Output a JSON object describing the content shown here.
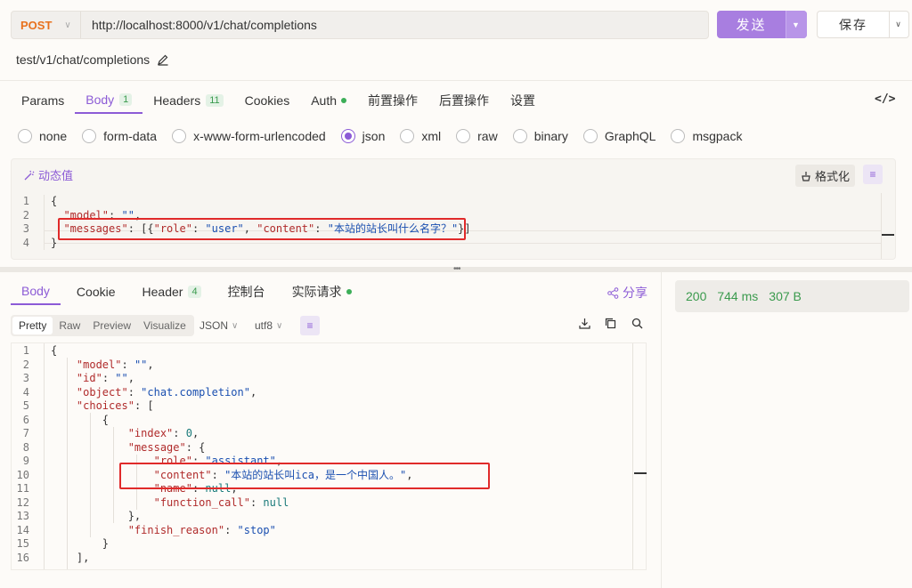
{
  "request": {
    "method": "POST",
    "url": "http://localhost:8000/v1/chat/completions",
    "send_label": "发送",
    "save_label": "保存",
    "path": "test/v1/chat/completions"
  },
  "req_tabs": [
    {
      "label": "Params"
    },
    {
      "label": "Body",
      "badge": "1",
      "active": true
    },
    {
      "label": "Headers",
      "badge": "11"
    },
    {
      "label": "Cookies"
    },
    {
      "label": "Auth",
      "dot": true
    },
    {
      "label": "前置操作"
    },
    {
      "label": "后置操作"
    },
    {
      "label": "设置"
    }
  ],
  "body_types": [
    {
      "label": "none"
    },
    {
      "label": "form-data"
    },
    {
      "label": "x-www-form-urlencoded"
    },
    {
      "label": "json",
      "checked": true
    },
    {
      "label": "xml"
    },
    {
      "label": "raw"
    },
    {
      "label": "binary"
    },
    {
      "label": "GraphQL"
    },
    {
      "label": "msgpack"
    }
  ],
  "editor": {
    "dynamic_label": "动态值",
    "format_label": "格式化"
  },
  "request_body_lines": [
    {
      "n": "1",
      "parts": [
        [
          "p",
          "{"
        ]
      ]
    },
    {
      "n": "2",
      "parts": [
        [
          "p",
          "  "
        ],
        [
          "k",
          "\"model\""
        ],
        [
          "p",
          ": "
        ],
        [
          "s",
          "\"\""
        ],
        [
          "p",
          ","
        ]
      ]
    },
    {
      "n": "3",
      "parts": [
        [
          "p",
          "  "
        ],
        [
          "k",
          "\"messages\""
        ],
        [
          "p",
          ": [{"
        ],
        [
          "k",
          "\"role\""
        ],
        [
          "p",
          ": "
        ],
        [
          "s",
          "\"user\""
        ],
        [
          "p",
          ", "
        ],
        [
          "k",
          "\"content\""
        ],
        [
          "p",
          ": "
        ],
        [
          "s",
          "\"本站的站长叫什么名字？\""
        ],
        [
          "p",
          "}]"
        ]
      ]
    },
    {
      "n": "4",
      "parts": [
        [
          "p",
          "}"
        ]
      ]
    }
  ],
  "resp_tabs": [
    {
      "label": "Body",
      "active": true
    },
    {
      "label": "Cookie"
    },
    {
      "label": "Header",
      "badge": "4"
    },
    {
      "label": "控制台"
    },
    {
      "label": "实际请求",
      "dot": true
    }
  ],
  "share_label": "分享",
  "view_modes": [
    {
      "label": "Pretty",
      "active": true
    },
    {
      "label": "Raw"
    },
    {
      "label": "Preview"
    },
    {
      "label": "Visualize"
    }
  ],
  "format_select": "JSON",
  "encoding_select": "utf8",
  "response_lines": [
    {
      "n": "1",
      "parts": [
        [
          "p",
          "{"
        ]
      ]
    },
    {
      "n": "2",
      "parts": [
        [
          "p",
          "    "
        ],
        [
          "k",
          "\"model\""
        ],
        [
          "p",
          ": "
        ],
        [
          "s",
          "\"\""
        ],
        [
          "p",
          ","
        ]
      ]
    },
    {
      "n": "3",
      "parts": [
        [
          "p",
          "    "
        ],
        [
          "k",
          "\"id\""
        ],
        [
          "p",
          ": "
        ],
        [
          "s",
          "\"\""
        ],
        [
          "p",
          ","
        ]
      ]
    },
    {
      "n": "4",
      "parts": [
        [
          "p",
          "    "
        ],
        [
          "k",
          "\"object\""
        ],
        [
          "p",
          ": "
        ],
        [
          "s",
          "\"chat.completion\""
        ],
        [
          "p",
          ","
        ]
      ]
    },
    {
      "n": "5",
      "parts": [
        [
          "p",
          "    "
        ],
        [
          "k",
          "\"choices\""
        ],
        [
          "p",
          ": ["
        ]
      ]
    },
    {
      "n": "6",
      "parts": [
        [
          "p",
          "        {"
        ]
      ]
    },
    {
      "n": "7",
      "parts": [
        [
          "p",
          "            "
        ],
        [
          "k",
          "\"index\""
        ],
        [
          "p",
          ": "
        ],
        [
          "n",
          "0"
        ],
        [
          "p",
          ","
        ]
      ]
    },
    {
      "n": "8",
      "parts": [
        [
          "p",
          "            "
        ],
        [
          "k",
          "\"message\""
        ],
        [
          "p",
          ": {"
        ]
      ]
    },
    {
      "n": "9",
      "parts": [
        [
          "p",
          "                "
        ],
        [
          "k",
          "\"role\""
        ],
        [
          "p",
          ": "
        ],
        [
          "s",
          "\"assistant\""
        ],
        [
          "p",
          ","
        ]
      ]
    },
    {
      "n": "10",
      "parts": [
        [
          "p",
          "                "
        ],
        [
          "k",
          "\"content\""
        ],
        [
          "p",
          ": "
        ],
        [
          "s",
          "\"本站的站长叫ica，是一个中国人。\""
        ],
        [
          "p",
          ","
        ]
      ]
    },
    {
      "n": "11",
      "parts": [
        [
          "p",
          "                "
        ],
        [
          "k",
          "\"name\""
        ],
        [
          "p",
          ": "
        ],
        [
          "n",
          "null"
        ],
        [
          "p",
          ","
        ]
      ]
    },
    {
      "n": "12",
      "parts": [
        [
          "p",
          "                "
        ],
        [
          "k",
          "\"function_call\""
        ],
        [
          "p",
          ": "
        ],
        [
          "n",
          "null"
        ]
      ]
    },
    {
      "n": "13",
      "parts": [
        [
          "p",
          "            },"
        ]
      ]
    },
    {
      "n": "14",
      "parts": [
        [
          "p",
          "            "
        ],
        [
          "k",
          "\"finish_reason\""
        ],
        [
          "p",
          ": "
        ],
        [
          "s",
          "\"stop\""
        ]
      ]
    },
    {
      "n": "15",
      "parts": [
        [
          "p",
          "        }"
        ]
      ]
    },
    {
      "n": "16",
      "parts": [
        [
          "p",
          "    ],"
        ]
      ]
    }
  ],
  "status": {
    "code": "200",
    "time": "744 ms",
    "size": "307 B"
  },
  "colors": {
    "accent": "#8c5bd6",
    "method": "#e8711d",
    "status": "#3a9a4d",
    "highlight": "#e02a2a"
  }
}
